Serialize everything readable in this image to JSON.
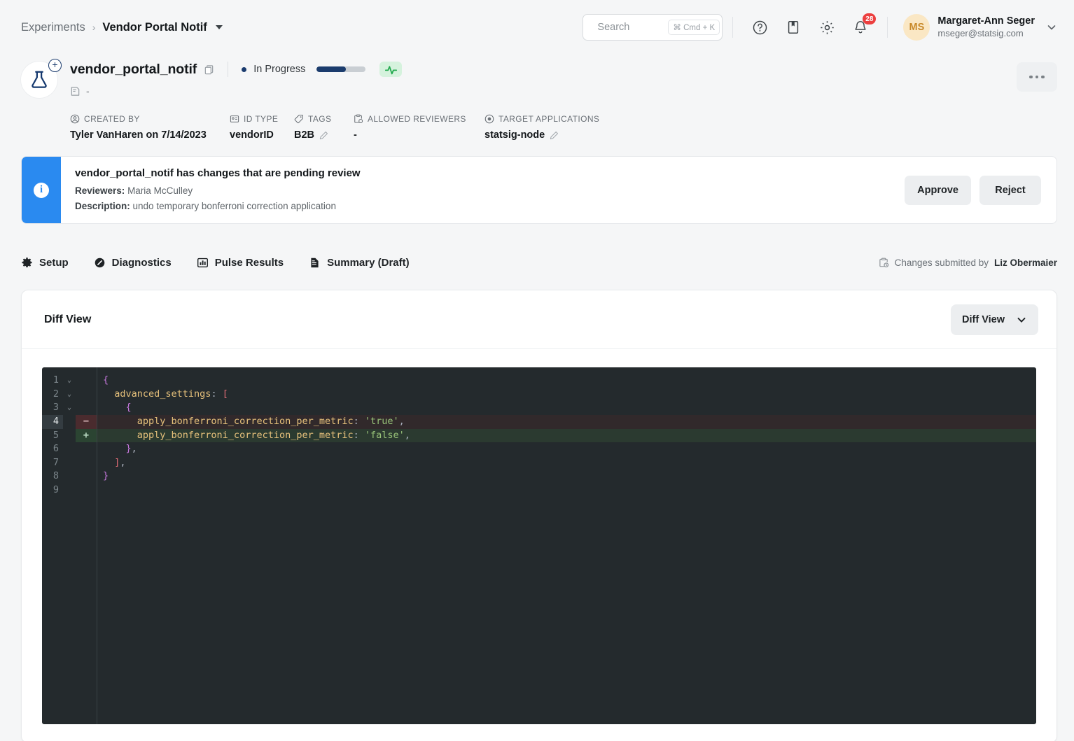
{
  "topbar": {
    "breadcrumb": {
      "root": "Experiments",
      "separator": "›",
      "current": "Vendor Portal Notif"
    },
    "search": {
      "placeholder": "Search",
      "value": "",
      "shortcut": "⌘ Cmd + K"
    },
    "icons": {
      "help": "help-icon",
      "docs": "book-icon",
      "settings": "gear-icon",
      "notifications": "bell-icon"
    },
    "notification_count": "28",
    "user": {
      "initials": "MS",
      "name": "Margaret-Ann Seger",
      "email": "mseger@statsig.com"
    }
  },
  "experiment": {
    "name": "vendor_portal_notif",
    "description_placeholder": "-",
    "status": "In Progress",
    "progress_percent": 60,
    "meta": [
      {
        "label": "CREATED BY",
        "value": "Tyler VanHaren on 7/14/2023",
        "icon": "user-circle-icon",
        "editable": false
      },
      {
        "label": "ID TYPE",
        "value": "vendorID",
        "icon": "id-card-icon",
        "editable": false
      },
      {
        "label": "TAGS",
        "value": "B2B",
        "icon": "tag-icon",
        "editable": true
      },
      {
        "label": "ALLOWED REVIEWERS",
        "value": "-",
        "icon": "clipboard-user-icon",
        "editable": false
      },
      {
        "label": "TARGET APPLICATIONS",
        "value": "statsig-node",
        "icon": "target-icon",
        "editable": true
      }
    ],
    "more_menu": "•••"
  },
  "banner": {
    "title": "vendor_portal_notif has changes that are pending review",
    "reviewers_label": "Reviewers:",
    "reviewers_value": "Maria McCulley",
    "description_label": "Description:",
    "description_value": "undo temporary bonferroni correction application",
    "approve_label": "Approve",
    "reject_label": "Reject"
  },
  "tabs": [
    {
      "label": "Setup",
      "icon": "gear-icon",
      "active": false
    },
    {
      "label": "Diagnostics",
      "icon": "diagnostics-icon",
      "active": false
    },
    {
      "label": "Pulse Results",
      "icon": "bar-chart-icon",
      "active": false
    },
    {
      "label": "Summary (Draft)",
      "icon": "document-icon",
      "active": true
    }
  ],
  "submitted_by": {
    "prefix": "Changes submitted by",
    "name": "Liz Obermaier"
  },
  "diff_card": {
    "title": "Diff View",
    "view_selector_label": "Diff View",
    "lines": [
      {
        "num": "1",
        "fold": "⌄",
        "sign": "",
        "type": "ctx",
        "tokens": [
          {
            "t": "{",
            "c": "punc"
          }
        ]
      },
      {
        "num": "2",
        "fold": "⌄",
        "sign": "",
        "type": "ctx",
        "tokens": [
          {
            "t": "  advanced_settings",
            "c": "key"
          },
          {
            "t": ": ",
            "c": "plain"
          },
          {
            "t": "[",
            "c": "brk"
          }
        ]
      },
      {
        "num": "3",
        "fold": "⌄",
        "sign": "",
        "type": "ctx",
        "tokens": [
          {
            "t": "    {",
            "c": "punc"
          }
        ]
      },
      {
        "num": "4",
        "fold": "",
        "sign": "−",
        "type": "del",
        "tokens": [
          {
            "t": "      apply_bonferroni_correction_per_metric",
            "c": "key"
          },
          {
            "t": ": ",
            "c": "plain"
          },
          {
            "t": "'true'",
            "c": "str"
          },
          {
            "t": ",",
            "c": "plain"
          }
        ]
      },
      {
        "num": "5",
        "fold": "",
        "sign": "+",
        "type": "add",
        "tokens": [
          {
            "t": "      apply_bonferroni_correction_per_metric",
            "c": "key"
          },
          {
            "t": ": ",
            "c": "plain"
          },
          {
            "t": "'false'",
            "c": "str"
          },
          {
            "t": ",",
            "c": "plain"
          }
        ]
      },
      {
        "num": "6",
        "fold": "",
        "sign": "",
        "type": "ctx",
        "tokens": [
          {
            "t": "    }",
            "c": "punc"
          },
          {
            "t": ",",
            "c": "plain"
          }
        ]
      },
      {
        "num": "7",
        "fold": "",
        "sign": "",
        "type": "ctx",
        "tokens": [
          {
            "t": "  ]",
            "c": "brk"
          },
          {
            "t": ",",
            "c": "plain"
          }
        ]
      },
      {
        "num": "8",
        "fold": "",
        "sign": "",
        "type": "ctx",
        "tokens": [
          {
            "t": "}",
            "c": "punc"
          }
        ]
      },
      {
        "num": "9",
        "fold": "",
        "sign": "",
        "type": "ctx",
        "tokens": []
      }
    ]
  },
  "colors": {
    "page_bg": "#f5f6f7",
    "accent_blue": "#2a8af0",
    "progress_fill": "#1b3c6d",
    "pulse_green": "#22a94e",
    "badge_red": "#ec3f3f",
    "editor_bg": "#242a2d",
    "diff_add_bg": "#2b3a30",
    "diff_del_bg": "#31292b"
  }
}
